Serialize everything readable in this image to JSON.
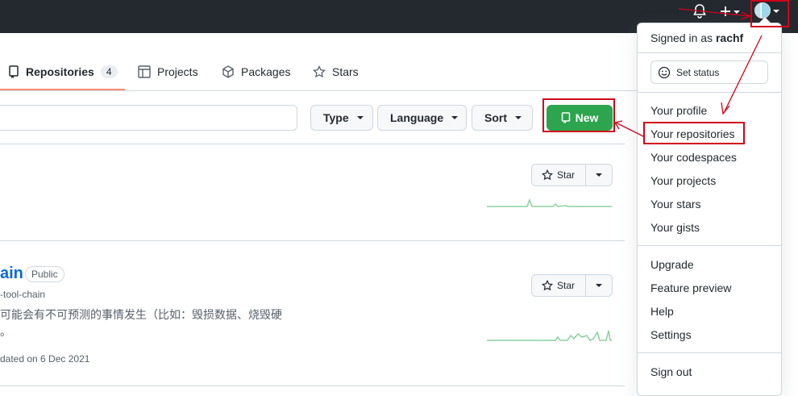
{
  "header": {
    "icons": [
      "bell-icon",
      "plus-icon",
      "avatar"
    ]
  },
  "tabs": [
    {
      "label": "Repositories",
      "count": "4",
      "icon": "repo-icon",
      "selected": true
    },
    {
      "label": "Projects",
      "icon": "table-icon"
    },
    {
      "label": "Packages",
      "icon": "package-icon"
    },
    {
      "label": "Stars",
      "icon": "star-icon"
    }
  ],
  "filters": {
    "type_label": "Type",
    "language_label": "Language",
    "sort_label": "Sort",
    "new_label": "New"
  },
  "repos": [
    {
      "star_label": "Star"
    },
    {
      "name": "ain",
      "visibility": "Public",
      "fork_text": "-tool-chain",
      "description_line1": "可能会有不可预测的事情发生（比如：毁损数据、烧毁硬",
      "description_line2": "‌。",
      "updated": "dated on 6 Dec 2021",
      "star_label": "Star"
    }
  ],
  "menu": {
    "signed_in_prefix": "Signed in as",
    "username": "rachf",
    "set_status": "Set status",
    "items_group1": [
      "Your profile",
      "Your repositories",
      "Your codespaces",
      "Your projects",
      "Your stars",
      "Your gists"
    ],
    "items_group2": [
      "Upgrade",
      "Feature preview",
      "Help",
      "Settings"
    ],
    "sign_out": "Sign out"
  },
  "colors": {
    "header_bg": "#24292f",
    "new_button": "#2da44e",
    "annotation": "#d0021b",
    "tab_underline": "#fd8c73",
    "sparkline": "#8ad0a0"
  }
}
